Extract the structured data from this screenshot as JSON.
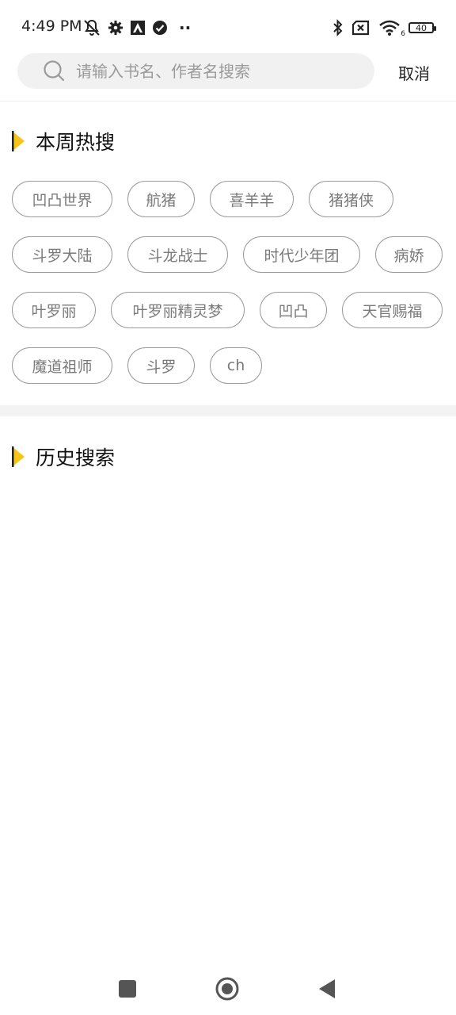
{
  "status_bar": {
    "time": "4:49 PM",
    "left_icons": [
      "bell-muted-icon",
      "settings-gear-icon",
      "app-icon",
      "check-circle-icon",
      "more-dots-icon"
    ],
    "more_dots": "··",
    "right_icons": [
      "bluetooth-icon",
      "no-sim-icon",
      "wifi-icon",
      "battery-icon"
    ],
    "wifi_sub": "6",
    "battery_level": "40"
  },
  "search": {
    "placeholder": "请输入书名、作者名搜索",
    "value": "",
    "cancel_label": "取消"
  },
  "hot_search": {
    "title": "本周热搜",
    "accent_color": "#f5c518",
    "tags": [
      "凹凸世界",
      "航猪",
      "喜羊羊",
      "猪猪侠",
      "斗罗大陆",
      "斗龙战士",
      "时代少年团",
      "病娇",
      "叶罗丽",
      "叶罗丽精灵梦",
      "凹凸",
      "天官赐福",
      "魔道祖师",
      "斗罗",
      "ch"
    ]
  },
  "history_search": {
    "title": "历史搜索",
    "items": []
  },
  "nav_bar": {
    "buttons": [
      "recents-square-icon",
      "home-circle-icon",
      "back-triangle-icon"
    ]
  }
}
